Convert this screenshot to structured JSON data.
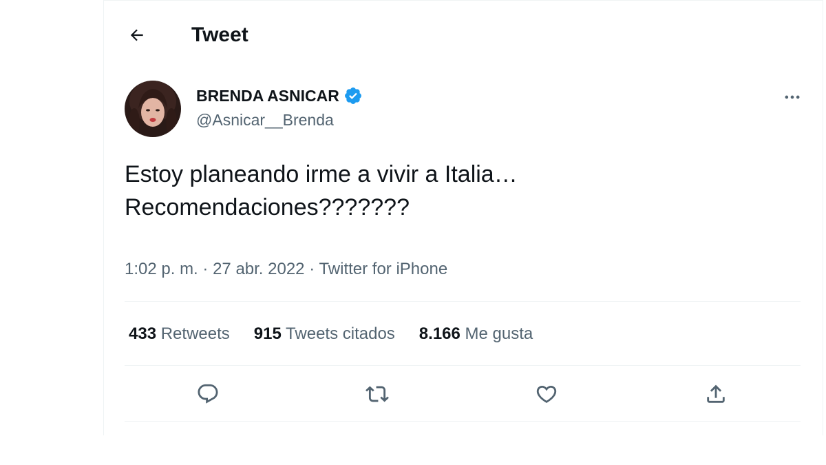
{
  "header": {
    "title": "Tweet",
    "back_icon": "arrow-left-icon"
  },
  "tweet": {
    "author": {
      "display_name": "BRENDA ASNICAR",
      "handle": "@Asnicar__Brenda",
      "verified": true
    },
    "text": "Estoy planeando irme a vivir a Italia…\nRecomendaciones???????",
    "time": "1:02 p. m.",
    "date": "27 abr. 2022",
    "source": "Twitter for iPhone",
    "separator": "·"
  },
  "stats": {
    "retweets_count": "433",
    "retweets_label": "Retweets",
    "quotes_count": "915",
    "quotes_label": "Tweets citados",
    "likes_count": "8.166",
    "likes_label": "Me gusta"
  },
  "actions": [
    {
      "name": "reply",
      "icon": "reply-icon"
    },
    {
      "name": "retweet",
      "icon": "retweet-icon"
    },
    {
      "name": "like",
      "icon": "heart-icon"
    },
    {
      "name": "share",
      "icon": "share-icon"
    }
  ],
  "colors": {
    "text": "#0f1419",
    "secondary": "#536471",
    "verified": "#1d9bf0",
    "divider": "#eff3f4"
  }
}
